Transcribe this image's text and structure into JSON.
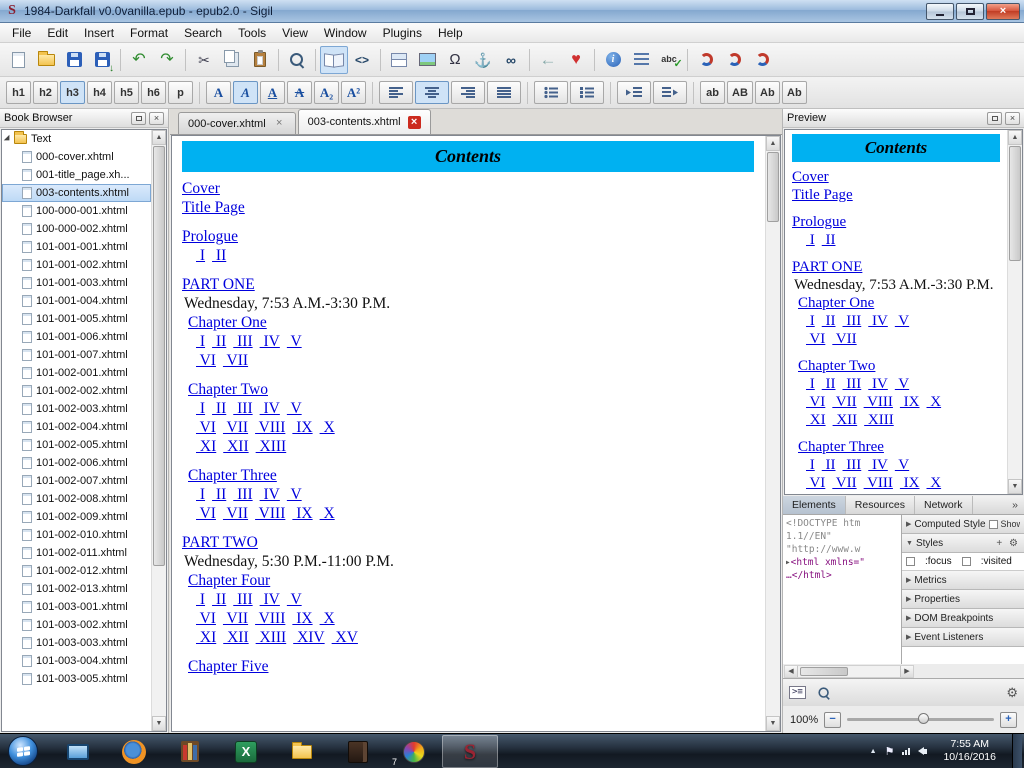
{
  "window": {
    "title": "1984-Darkfall v0.0vanilla.epub - epub2.0 - Sigil"
  },
  "menu": [
    "File",
    "Edit",
    "Insert",
    "Format",
    "Search",
    "Tools",
    "View",
    "Window",
    "Plugins",
    "Help"
  ],
  "toolbar_main": [
    {
      "name": "new-file",
      "glyph": "page"
    },
    {
      "name": "open-file",
      "glyph": "folder"
    },
    {
      "name": "save",
      "glyph": "save"
    },
    {
      "name": "save-as",
      "glyph": "saveas"
    },
    {
      "sep": true
    },
    {
      "name": "undo",
      "glyph": "undo"
    },
    {
      "name": "redo",
      "glyph": "redo"
    },
    {
      "sep": true
    },
    {
      "name": "cut",
      "glyph": "cut"
    },
    {
      "name": "copy",
      "glyph": "copy"
    },
    {
      "name": "paste",
      "glyph": "paste"
    },
    {
      "sep": true
    },
    {
      "name": "find-replace",
      "glyph": "find"
    },
    {
      "sep": true
    },
    {
      "name": "book-view",
      "glyph": "book",
      "pressed": true
    },
    {
      "name": "code-view",
      "glyph": "code"
    },
    {
      "sep": true
    },
    {
      "name": "split-view",
      "glyph": "split"
    },
    {
      "name": "insert-image",
      "glyph": "image"
    },
    {
      "name": "special-characters",
      "glyph": "omega"
    },
    {
      "name": "insert-id",
      "glyph": "anchor"
    },
    {
      "name": "insert-link",
      "glyph": "link"
    },
    {
      "sep": true
    },
    {
      "name": "back-to-link",
      "glyph": "back"
    },
    {
      "name": "donate",
      "glyph": "heart"
    },
    {
      "sep": true
    },
    {
      "name": "metadata-editor",
      "glyph": "info"
    },
    {
      "name": "toc-editor",
      "glyph": "toc"
    },
    {
      "name": "spellcheck",
      "glyph": "spell"
    },
    {
      "sep": true
    },
    {
      "name": "clip-tool-1",
      "glyph": "swirl"
    },
    {
      "name": "clip-tool-2",
      "glyph": "swirl"
    },
    {
      "name": "clip-tool-3",
      "glyph": "swirl"
    }
  ],
  "toolbar_format": [
    {
      "name": "heading-1",
      "label": "h1"
    },
    {
      "name": "heading-2",
      "label": "h2"
    },
    {
      "name": "heading-3",
      "label": "h3",
      "pressed": true
    },
    {
      "name": "heading-4",
      "label": "h4"
    },
    {
      "name": "heading-5",
      "label": "h5"
    },
    {
      "name": "heading-6",
      "label": "h6"
    },
    {
      "name": "paragraph",
      "label": "p"
    },
    {
      "sep": true
    },
    {
      "name": "bold",
      "label": "A",
      "cls": "lbl-blue g-b"
    },
    {
      "name": "italic",
      "label": "A",
      "cls": "lbl-blue g-i",
      "pressed": true
    },
    {
      "name": "underline",
      "label": "A",
      "cls": "lbl-blue g-u"
    },
    {
      "name": "strikethrough",
      "label": "A",
      "cls": "lbl-blue g-s"
    },
    {
      "name": "subscript",
      "label": "A₂",
      "cls": "lbl-blue"
    },
    {
      "name": "superscript",
      "label": "A²",
      "cls": "lbl-blue"
    },
    {
      "sep": true
    },
    {
      "name": "align-left",
      "glyph": "alL"
    },
    {
      "name": "align-center",
      "glyph": "alC",
      "pressed": true
    },
    {
      "name": "align-right",
      "glyph": "alR"
    },
    {
      "name": "align-justify",
      "glyph": "alJ"
    },
    {
      "sep": true
    },
    {
      "name": "bullet-list",
      "glyph": "ulist"
    },
    {
      "name": "numbered-list",
      "glyph": "olist"
    },
    {
      "sep": true
    },
    {
      "name": "outdent",
      "glyph": "outd"
    },
    {
      "name": "indent",
      "glyph": "ind"
    },
    {
      "sep": true
    },
    {
      "name": "lowercase",
      "label": "ab"
    },
    {
      "name": "uppercase",
      "label": "AB"
    },
    {
      "name": "titlecase",
      "label": "Ab"
    },
    {
      "name": "capitalize",
      "label": "Ab"
    }
  ],
  "book_browser": {
    "title": "Book Browser",
    "folder": "Text",
    "selected_index": 2,
    "files": [
      "000-cover.xhtml",
      "001-title_page.xh...",
      "003-contents.xhtml",
      "100-000-001.xhtml",
      "100-000-002.xhtml",
      "101-001-001.xhtml",
      "101-001-002.xhtml",
      "101-001-003.xhtml",
      "101-001-004.xhtml",
      "101-001-005.xhtml",
      "101-001-006.xhtml",
      "101-001-007.xhtml",
      "101-002-001.xhtml",
      "101-002-002.xhtml",
      "101-002-003.xhtml",
      "101-002-004.xhtml",
      "101-002-005.xhtml",
      "101-002-006.xhtml",
      "101-002-007.xhtml",
      "101-002-008.xhtml",
      "101-002-009.xhtml",
      "101-002-010.xhtml",
      "101-002-011.xhtml",
      "101-002-012.xhtml",
      "101-002-013.xhtml",
      "101-003-001.xhtml",
      "101-003-002.xhtml",
      "101-003-003.xhtml",
      "101-003-004.xhtml",
      "101-003-005.xhtml"
    ]
  },
  "tabs": [
    {
      "label": "000-cover.xhtml",
      "active": false
    },
    {
      "label": "003-contents.xhtml",
      "active": true
    }
  ],
  "doc": {
    "title": "Contents",
    "blocks": [
      {
        "t": "link",
        "text": "Cover"
      },
      {
        "t": "link",
        "text": "Title Page"
      },
      {
        "t": "gap"
      },
      {
        "t": "link",
        "text": "Prologue"
      },
      {
        "t": "nums",
        "items": [
          "I",
          "II"
        ]
      },
      {
        "t": "gap"
      },
      {
        "t": "link",
        "text": "PART ONE"
      },
      {
        "t": "text",
        "text": "Wednesday, 7:53 A.M.-3:30 P.M."
      },
      {
        "t": "chapter",
        "text": "Chapter One"
      },
      {
        "t": "nums",
        "items": [
          "I",
          "II",
          "III",
          "IV",
          "V"
        ]
      },
      {
        "t": "nums",
        "items": [
          "VI",
          "VII"
        ]
      },
      {
        "t": "gap"
      },
      {
        "t": "chapter",
        "text": "Chapter Two"
      },
      {
        "t": "nums",
        "items": [
          "I",
          "II",
          "III",
          "IV",
          "V"
        ]
      },
      {
        "t": "nums",
        "items": [
          "VI",
          "VII",
          "VIII",
          "IX",
          "X"
        ]
      },
      {
        "t": "nums",
        "items": [
          "XI",
          "XII",
          "XIII"
        ]
      },
      {
        "t": "gap"
      },
      {
        "t": "chapter",
        "text": "Chapter Three"
      },
      {
        "t": "nums",
        "items": [
          "I",
          "II",
          "III",
          "IV",
          "V"
        ]
      },
      {
        "t": "nums",
        "items": [
          "VI",
          "VII",
          "VIII",
          "IX",
          "X"
        ]
      },
      {
        "t": "gap"
      },
      {
        "t": "link",
        "text": "PART TWO"
      },
      {
        "t": "text",
        "text": "Wednesday, 5:30 P.M.-11:00 P.M."
      },
      {
        "t": "chapter",
        "text": "Chapter Four"
      },
      {
        "t": "nums",
        "items": [
          "I",
          "II",
          "III",
          "IV",
          "V"
        ]
      },
      {
        "t": "nums",
        "items": [
          "VI",
          "VII",
          "VIII",
          "IX",
          "X"
        ]
      },
      {
        "t": "nums",
        "items": [
          "XI",
          "XII",
          "XIII",
          "XIV",
          "XV"
        ]
      },
      {
        "t": "gap"
      },
      {
        "t": "chapter",
        "text": "Chapter Five"
      }
    ]
  },
  "preview": {
    "title": "Preview"
  },
  "devtools": {
    "tabs": [
      "Elements",
      "Resources",
      "Network"
    ],
    "overflow": "»",
    "code": [
      {
        "text": "<!DOCTYPE htm",
        "cls": "gray"
      },
      {
        "text": "1.1//EN\"",
        "cls": "gray"
      },
      {
        "text": "\"http://www.w",
        "cls": "gray"
      },
      {
        "text": "<html xmlns=\"",
        "cls": "tag",
        "arrow": true
      },
      {
        "text": "…</html>",
        "cls": "tag"
      }
    ],
    "panels": [
      {
        "label": "Computed Style",
        "arrow": "right"
      },
      {
        "label": "Styles",
        "arrow": "down"
      },
      {
        "label": "Metrics",
        "arrow": "right"
      },
      {
        "label": "Properties",
        "arrow": "right"
      },
      {
        "label": "DOM Breakpoints",
        "arrow": "right"
      },
      {
        "label": "Event Listeners",
        "arrow": "right"
      }
    ],
    "show_inherited": "Show inherited",
    "styles_tools": "+ ⚙",
    "states": [
      ":focus",
      ":visited"
    ],
    "toolbar_icons": [
      "console",
      "search",
      "settings"
    ]
  },
  "zoom": {
    "level": "100%"
  },
  "taskbar": {
    "icons": [
      {
        "name": "screen-capture"
      },
      {
        "name": "firefox"
      },
      {
        "name": "library"
      },
      {
        "name": "excel"
      },
      {
        "name": "file-explorer"
      },
      {
        "name": "journal"
      },
      {
        "name": "paint",
        "badge": "7"
      },
      {
        "name": "sigil",
        "active": true
      }
    ],
    "tray": [
      "hidden-icons",
      "flag",
      "network",
      "volume"
    ],
    "time": "7:55 AM",
    "date": "10/16/2016"
  },
  "colors": {
    "banner_cyan": "#00b1f1",
    "link_blue": "#0000dd",
    "selection_blue": "#bcd9f5"
  }
}
